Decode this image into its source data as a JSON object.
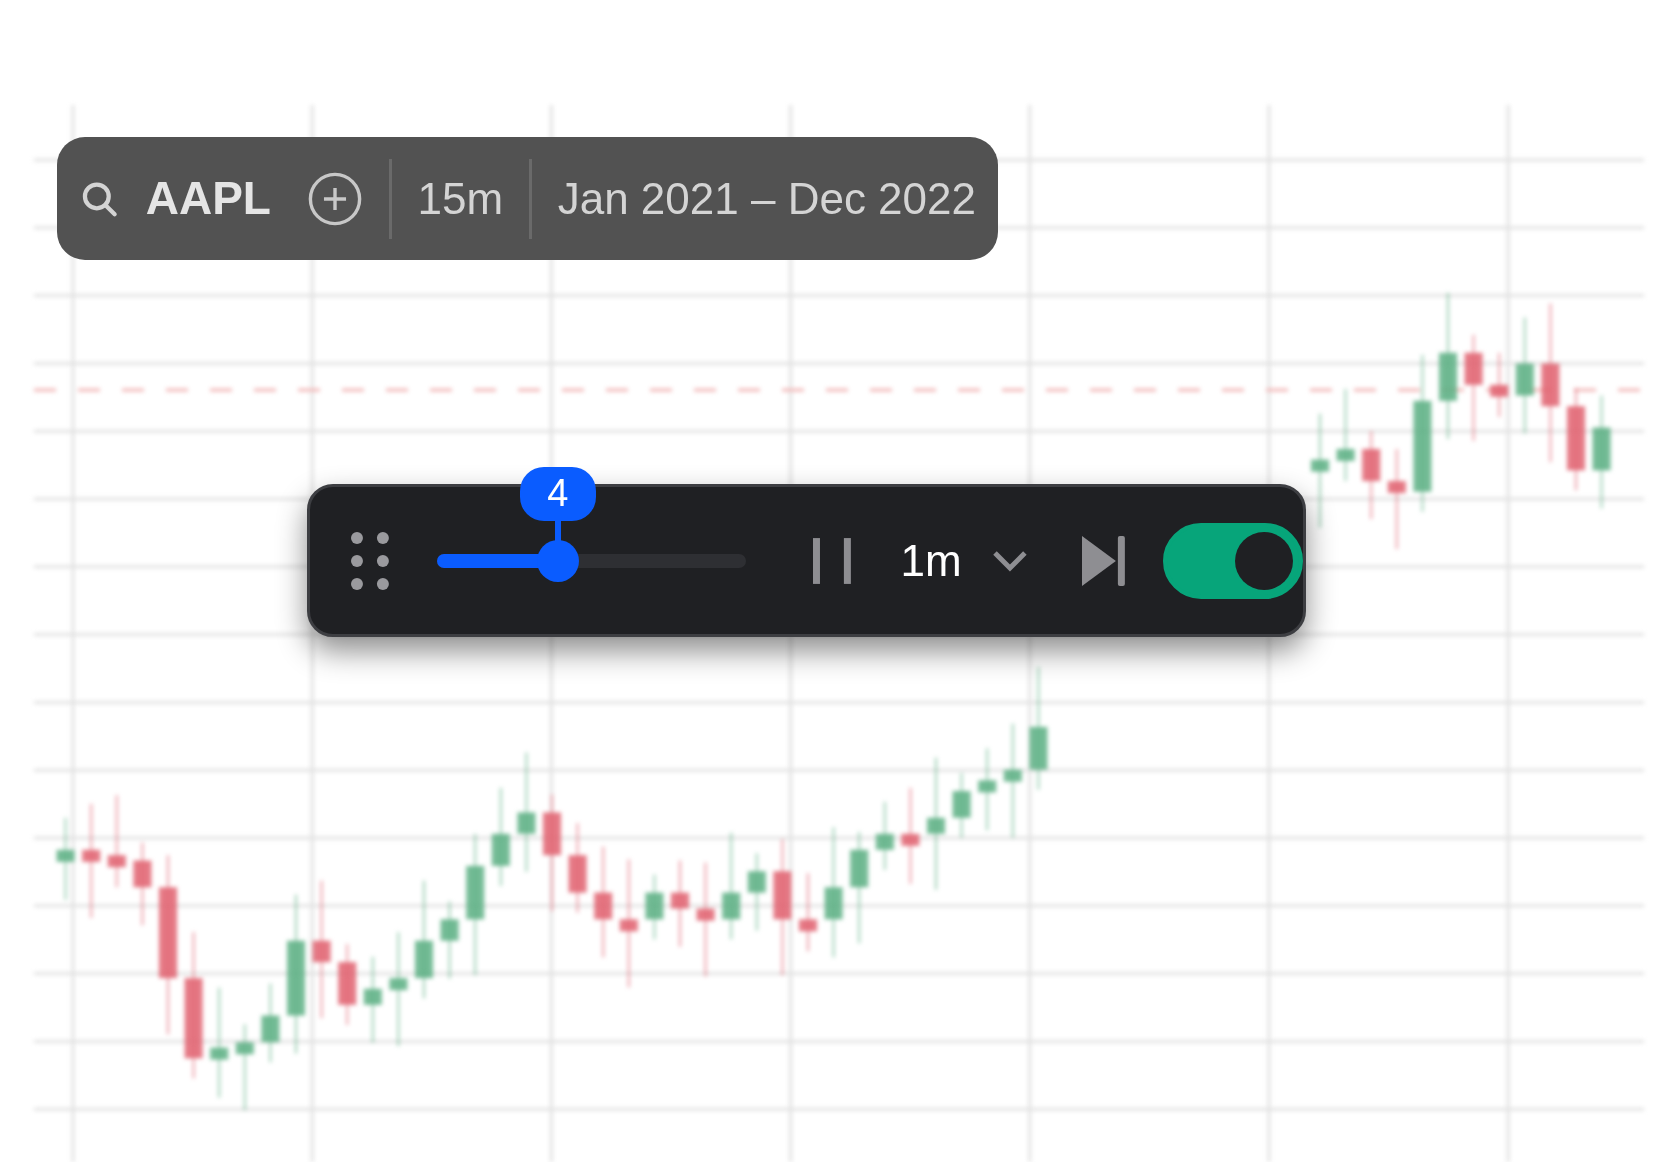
{
  "search_bar": {
    "symbol": "AAPL",
    "interval": "15m",
    "date_range": "Jan 2021 – Dec 2022"
  },
  "replay_bar": {
    "speed_badge": "4",
    "speed": {
      "level": 0.39
    },
    "interval": "1m",
    "toggle": {
      "on": true
    }
  }
}
